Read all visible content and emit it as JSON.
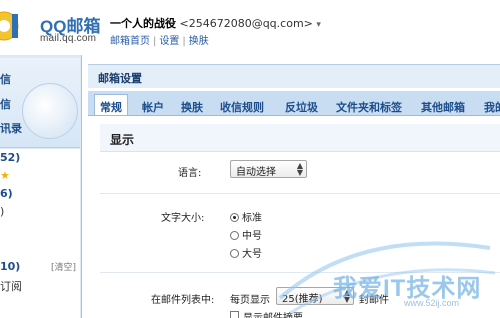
{
  "header": {
    "logo_title": "QQ邮箱",
    "logo_subtitle": "mail.qq.com",
    "user_name": "一个人的战役",
    "user_email": "<254672080@qq.com>",
    "caret": "▾",
    "links": [
      "邮箱首页",
      "设置",
      "换肤"
    ]
  },
  "sidebar": {
    "nav": [
      "信",
      "信",
      "讯录"
    ],
    "folders": [
      {
        "text": "52)"
      },
      {
        "text": "★"
      },
      {
        "text": "6)"
      },
      {
        "text": ")"
      },
      {
        "text": "10)"
      },
      {
        "text": "订阅"
      }
    ],
    "clear_label": "[清空]"
  },
  "main": {
    "title": "邮箱设置",
    "tabs": [
      "常规",
      "帐户",
      "换肤",
      "收信规则",
      "反垃圾",
      "文件夹和标签",
      "其他邮箱",
      "我的"
    ],
    "active_tab": 0,
    "section": "显示",
    "language": {
      "label": "语言:",
      "value": "自动选择"
    },
    "font_size": {
      "label": "文字大小:",
      "options": [
        "标准",
        "中号",
        "大号"
      ],
      "selected": 0
    },
    "mail_list": {
      "label": "在邮件列表中:",
      "per_page_label": "每页显示",
      "per_page_value": "25(推荐)",
      "suffix": "封邮件",
      "check_label": "显示邮件摘要"
    }
  },
  "watermark": {
    "text": "我爱IT技术网",
    "url": "www.52ij.com"
  }
}
